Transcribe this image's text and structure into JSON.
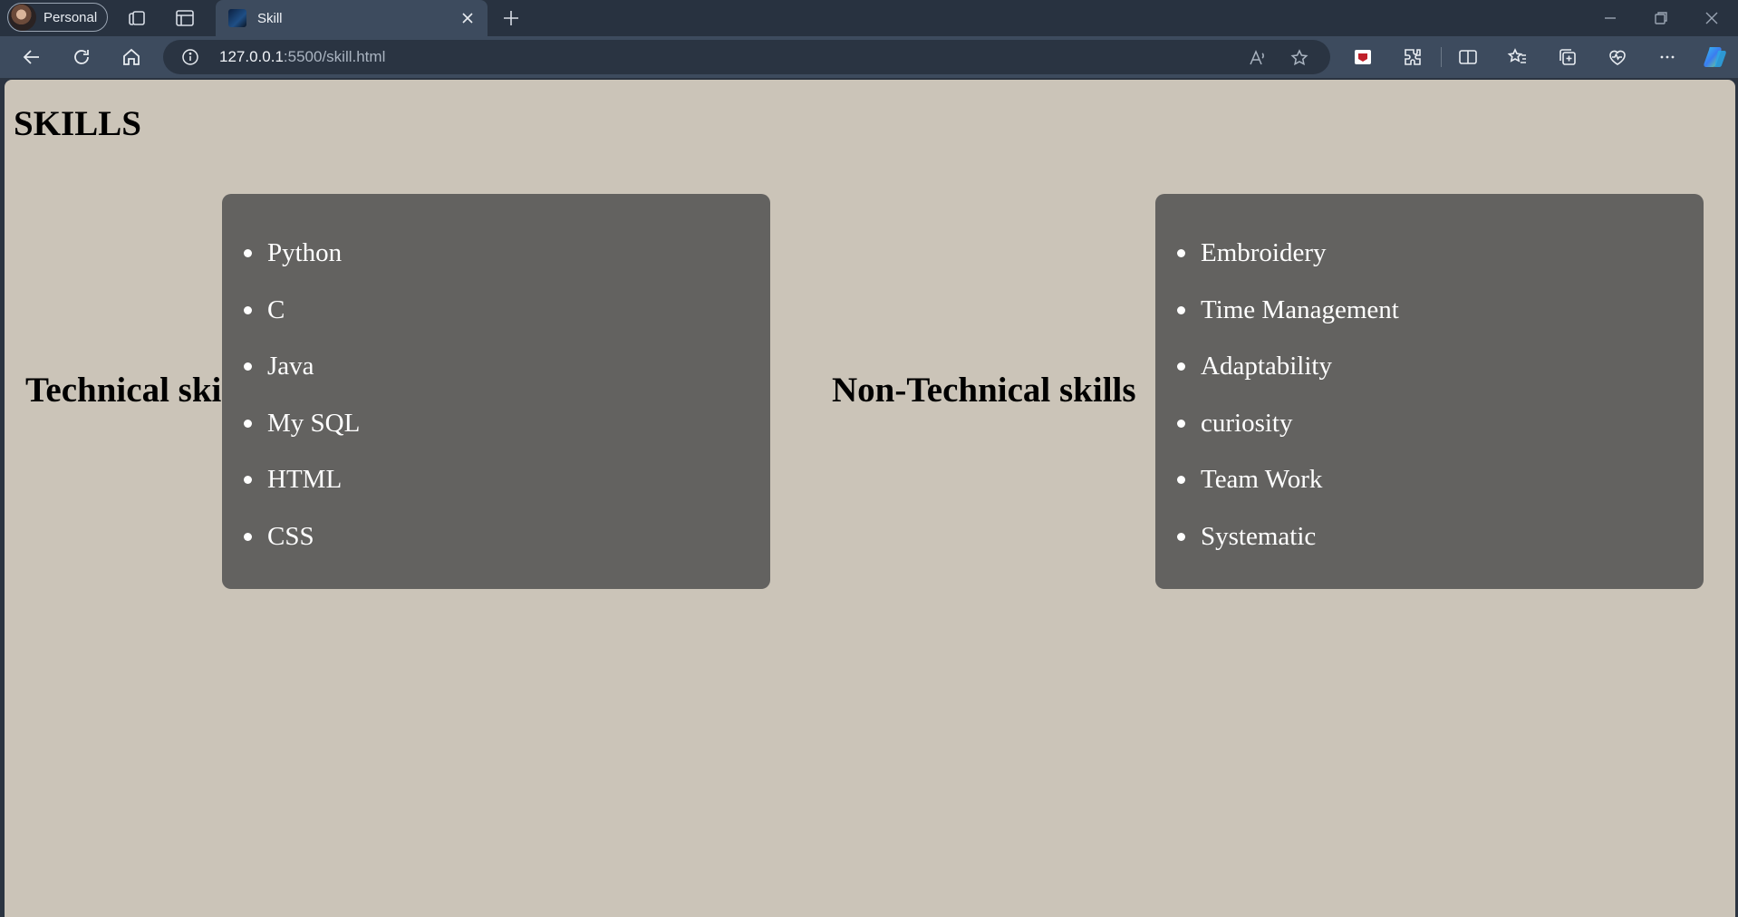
{
  "browser": {
    "profile_label": "Personal",
    "tab_title": "Skill",
    "url_host": "127.0.0.1",
    "url_rest": ":5500/skill.html"
  },
  "page": {
    "title": "SKILLS",
    "technical": {
      "label": "Technical skills",
      "items": [
        "Python",
        "C",
        "Java",
        "My SQL",
        "HTML",
        "CSS"
      ]
    },
    "non_technical": {
      "label": "Non-Technical skills",
      "items": [
        "Embroidery",
        "Time Management",
        "Adaptability",
        "curiosity",
        "Team Work",
        "Systematic"
      ]
    }
  },
  "colors": {
    "page_background": "#cbc4b8",
    "box_background": "#636260",
    "box_text": "#ffffff"
  }
}
